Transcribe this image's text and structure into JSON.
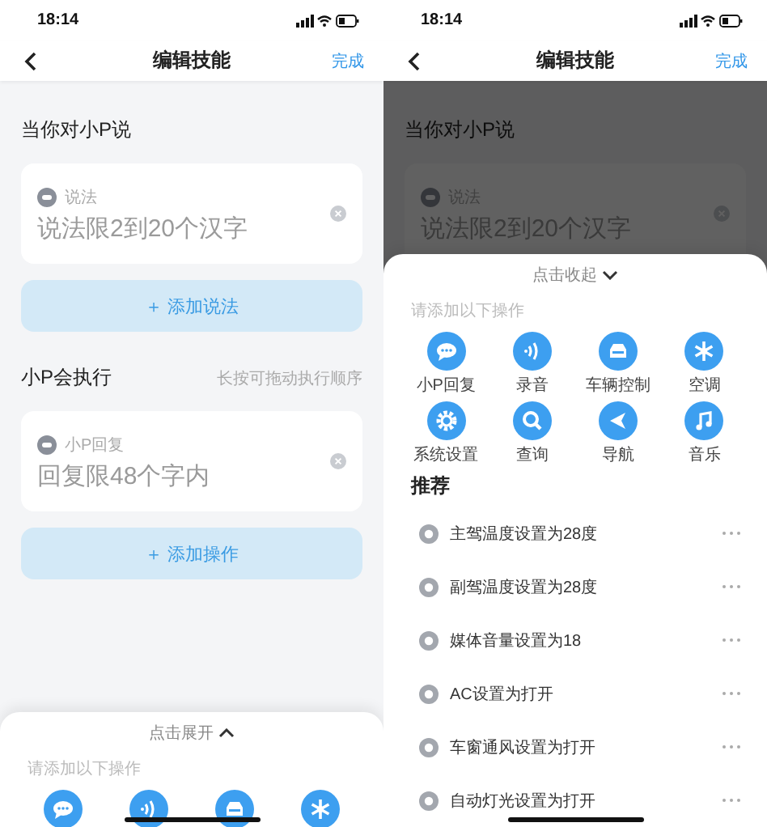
{
  "screens": [
    {
      "status_bar": {
        "time": "18:14"
      },
      "nav": {
        "title": "编辑技能",
        "done": "完成"
      },
      "dimmed": false,
      "sections": [
        {
          "title": "当你对小P说",
          "card": {
            "label": "说法",
            "placeholder": "说法限2到20个汉字"
          },
          "add_button": "＋ 添加说法"
        },
        {
          "title": "小P会执行",
          "hint": "长按可拖动执行顺序",
          "card": {
            "label": "小P回复",
            "placeholder": "回复限48个字内"
          },
          "add_button": "＋ 添加操作"
        }
      ],
      "sheet": {
        "expanded": false,
        "toggle": "点击展开",
        "hint": "请添加以下操作"
      }
    },
    {
      "status_bar": {
        "time": "18:14"
      },
      "nav": {
        "title": "编辑技能",
        "done": "完成"
      },
      "dimmed": true,
      "sections": [
        {
          "title": "当你对小P说",
          "card": {
            "label": "说法",
            "placeholder": "说法限2到20个汉字"
          }
        }
      ],
      "sheet": {
        "expanded": true,
        "toggle": "点击收起",
        "hint": "请添加以下操作",
        "actions": [
          {
            "label": "小P回复"
          },
          {
            "label": "录音"
          },
          {
            "label": "车辆控制"
          },
          {
            "label": "空调"
          },
          {
            "label": "系统设置"
          },
          {
            "label": "查询"
          },
          {
            "label": "导航"
          },
          {
            "label": "音乐"
          }
        ],
        "recommended_title": "推荐",
        "recommendations": [
          {
            "label": "主驾温度设置为28度"
          },
          {
            "label": "副驾温度设置为28度"
          },
          {
            "label": "媒体音量设置为18"
          },
          {
            "label": "AC设置为打开"
          },
          {
            "label": "车窗通风设置为打开"
          },
          {
            "label": "自动灯光设置为打开"
          }
        ]
      }
    }
  ]
}
